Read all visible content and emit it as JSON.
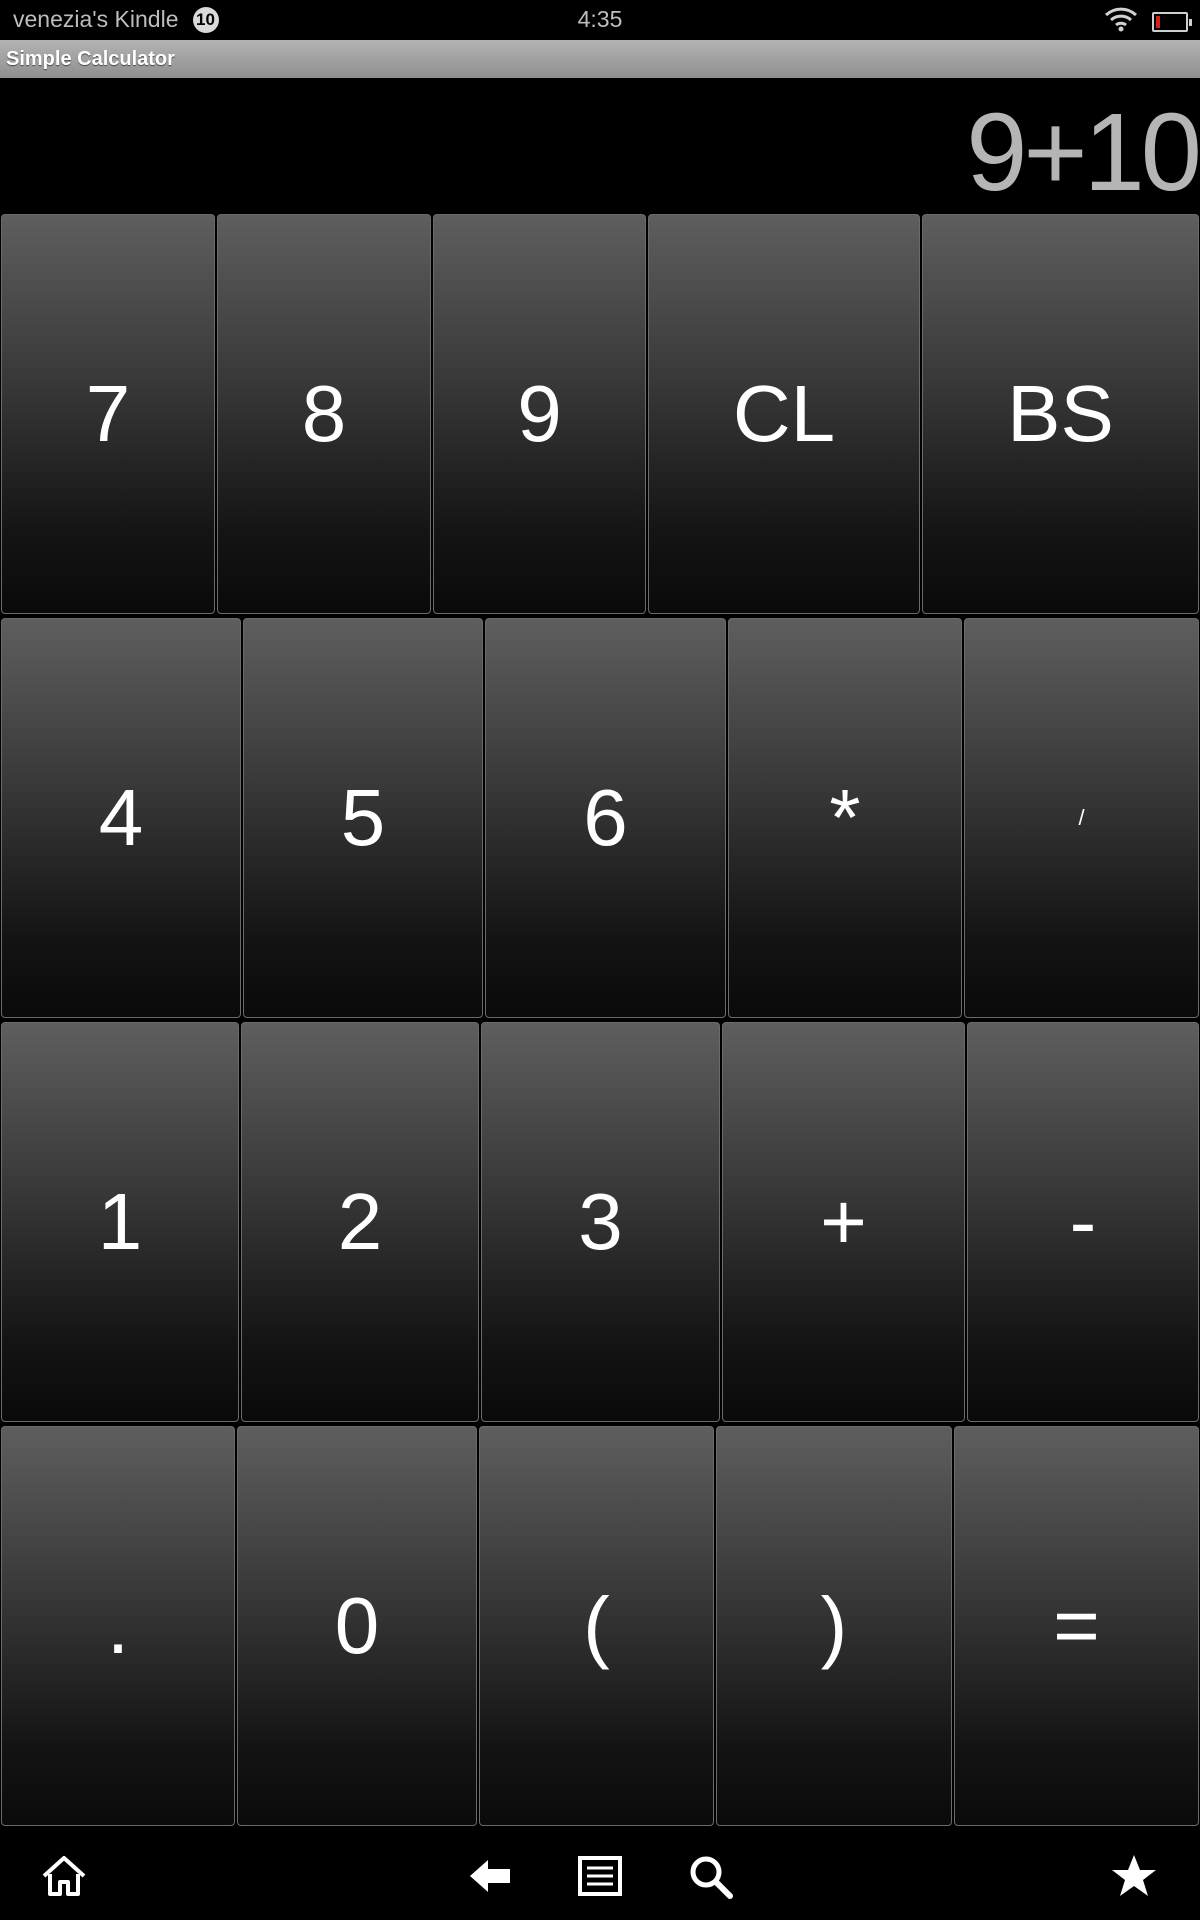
{
  "status_bar": {
    "device_name": "venezia's Kindle",
    "notification_count": "10",
    "time": "4:35",
    "wifi_icon": "wifi-icon",
    "battery_icon": "battery-low-icon"
  },
  "app": {
    "title": "Simple Calculator"
  },
  "display": {
    "expression": "9+10"
  },
  "keys": {
    "row1": [
      "7",
      "8",
      "9",
      "CL",
      "BS"
    ],
    "row2": [
      "4",
      "5",
      "6",
      "*",
      "/"
    ],
    "row3": [
      "1",
      "2",
      "3",
      "+",
      "-"
    ],
    "row4": [
      ".",
      "0",
      "(",
      ")",
      "="
    ]
  },
  "nav_bar": {
    "home_icon": "home-icon",
    "back_icon": "back-arrow-icon",
    "menu_icon": "menu-icon",
    "search_icon": "search-icon",
    "favorites_icon": "star-icon"
  },
  "colors": {
    "display_text": "#b5b5b5",
    "title_bar": "#9e9e9e",
    "battery_level": "#d21f1f"
  }
}
